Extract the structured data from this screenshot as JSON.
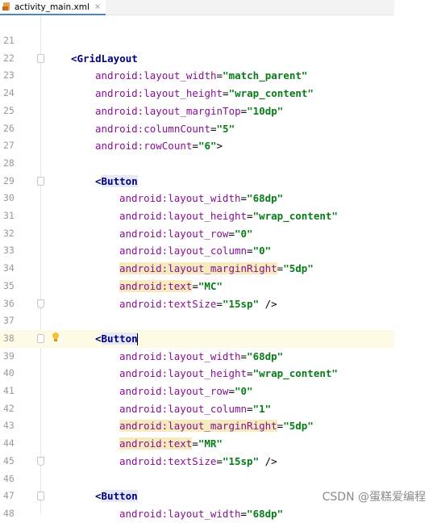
{
  "tab": {
    "filename": "activity_main.xml",
    "close_glyph": "×"
  },
  "watermark": "CSDN @蛋糕爱编程",
  "lines": [
    {
      "n": "21",
      "indent": 0,
      "parts": []
    },
    {
      "n": "22",
      "indent": 1,
      "fold": "open",
      "parts": [
        {
          "k": "tag",
          "t": "<GridLayout"
        }
      ]
    },
    {
      "n": "23",
      "indent": 2,
      "parts": [
        {
          "k": "attr",
          "t": "android:layout_width"
        },
        {
          "k": "eq",
          "t": "="
        },
        {
          "k": "val",
          "t": "\"match_parent\""
        }
      ]
    },
    {
      "n": "24",
      "indent": 2,
      "parts": [
        {
          "k": "attr",
          "t": "android:layout_height"
        },
        {
          "k": "eq",
          "t": "="
        },
        {
          "k": "val",
          "t": "\"wrap_content\""
        }
      ]
    },
    {
      "n": "25",
      "indent": 2,
      "parts": [
        {
          "k": "attr",
          "t": "android:layout_marginTop"
        },
        {
          "k": "eq",
          "t": "="
        },
        {
          "k": "val",
          "t": "\"10dp\""
        }
      ]
    },
    {
      "n": "26",
      "indent": 2,
      "parts": [
        {
          "k": "attr",
          "t": "android:columnCount"
        },
        {
          "k": "eq",
          "t": "="
        },
        {
          "k": "val",
          "t": "\"5\""
        }
      ]
    },
    {
      "n": "27",
      "indent": 2,
      "parts": [
        {
          "k": "attr",
          "t": "android:rowCount"
        },
        {
          "k": "eq",
          "t": "="
        },
        {
          "k": "val",
          "t": "\"6\""
        },
        {
          "k": "eq",
          "t": ">"
        }
      ]
    },
    {
      "n": "28",
      "indent": 0,
      "parts": []
    },
    {
      "n": "29",
      "indent": 2,
      "fold": "open",
      "parts": [
        {
          "k": "tagopen",
          "t": "<"
        },
        {
          "k": "taghl",
          "t": "Button"
        }
      ]
    },
    {
      "n": "30",
      "indent": 3,
      "parts": [
        {
          "k": "attr",
          "t": "android:layout_width"
        },
        {
          "k": "eq",
          "t": "="
        },
        {
          "k": "val",
          "t": "\"68dp\""
        }
      ]
    },
    {
      "n": "31",
      "indent": 3,
      "parts": [
        {
          "k": "attr",
          "t": "android:layout_height"
        },
        {
          "k": "eq",
          "t": "="
        },
        {
          "k": "val",
          "t": "\"wrap_content\""
        }
      ]
    },
    {
      "n": "32",
      "indent": 3,
      "parts": [
        {
          "k": "attr",
          "t": "android:layout_row"
        },
        {
          "k": "eq",
          "t": "="
        },
        {
          "k": "val",
          "t": "\"0\""
        }
      ]
    },
    {
      "n": "33",
      "indent": 3,
      "parts": [
        {
          "k": "attr",
          "t": "android:layout_column"
        },
        {
          "k": "eq",
          "t": "="
        },
        {
          "k": "val",
          "t": "\"0\""
        }
      ]
    },
    {
      "n": "34",
      "indent": 3,
      "parts": [
        {
          "k": "attrhl",
          "t": "android:layout_marginRight"
        },
        {
          "k": "eq",
          "t": "="
        },
        {
          "k": "val",
          "t": "\"5dp\""
        }
      ]
    },
    {
      "n": "35",
      "indent": 3,
      "parts": [
        {
          "k": "attrhl",
          "t": "android:text"
        },
        {
          "k": "eq",
          "t": "="
        },
        {
          "k": "val",
          "t": "\"MC\""
        }
      ]
    },
    {
      "n": "36",
      "indent": 3,
      "fold": "close",
      "parts": [
        {
          "k": "attr",
          "t": "android:textSize"
        },
        {
          "k": "eq",
          "t": "="
        },
        {
          "k": "val",
          "t": "\"15sp\""
        },
        {
          "k": "eq",
          "t": " />"
        }
      ]
    },
    {
      "n": "37",
      "indent": 0,
      "parts": []
    },
    {
      "n": "38",
      "indent": 2,
      "fold": "open",
      "current": true,
      "bulb": true,
      "caret": true,
      "parts": [
        {
          "k": "tagopen",
          "t": "<"
        },
        {
          "k": "taghl",
          "t": "Button"
        }
      ]
    },
    {
      "n": "39",
      "indent": 3,
      "parts": [
        {
          "k": "attr",
          "t": "android:layout_width"
        },
        {
          "k": "eq",
          "t": "="
        },
        {
          "k": "val",
          "t": "\"68dp\""
        }
      ]
    },
    {
      "n": "40",
      "indent": 3,
      "parts": [
        {
          "k": "attr",
          "t": "android:layout_height"
        },
        {
          "k": "eq",
          "t": "="
        },
        {
          "k": "val",
          "t": "\"wrap_content\""
        }
      ]
    },
    {
      "n": "41",
      "indent": 3,
      "parts": [
        {
          "k": "attr",
          "t": "android:layout_row"
        },
        {
          "k": "eq",
          "t": "="
        },
        {
          "k": "val",
          "t": "\"0\""
        }
      ]
    },
    {
      "n": "42",
      "indent": 3,
      "parts": [
        {
          "k": "attr",
          "t": "android:layout_column"
        },
        {
          "k": "eq",
          "t": "="
        },
        {
          "k": "val",
          "t": "\"1\""
        }
      ]
    },
    {
      "n": "43",
      "indent": 3,
      "parts": [
        {
          "k": "attrhl",
          "t": "android:layout_marginRight"
        },
        {
          "k": "eq",
          "t": "="
        },
        {
          "k": "val",
          "t": "\"5dp\""
        }
      ]
    },
    {
      "n": "44",
      "indent": 3,
      "parts": [
        {
          "k": "attrhl",
          "t": "android:text"
        },
        {
          "k": "eq",
          "t": "="
        },
        {
          "k": "val",
          "t": "\"MR\""
        }
      ]
    },
    {
      "n": "45",
      "indent": 3,
      "fold": "close",
      "parts": [
        {
          "k": "attr",
          "t": "android:textSize"
        },
        {
          "k": "eq",
          "t": "="
        },
        {
          "k": "val",
          "t": "\"15sp\""
        },
        {
          "k": "eq",
          "t": " />"
        }
      ]
    },
    {
      "n": "46",
      "indent": 0,
      "parts": []
    },
    {
      "n": "47",
      "indent": 2,
      "fold": "open",
      "parts": [
        {
          "k": "tagopen",
          "t": "<"
        },
        {
          "k": "taghl",
          "t": "Button"
        }
      ]
    },
    {
      "n": "48",
      "indent": 3,
      "parts": [
        {
          "k": "attr",
          "t": "android:layout_width"
        },
        {
          "k": "eq",
          "t": "="
        },
        {
          "k": "val",
          "t": "\"68dp\""
        }
      ]
    }
  ]
}
